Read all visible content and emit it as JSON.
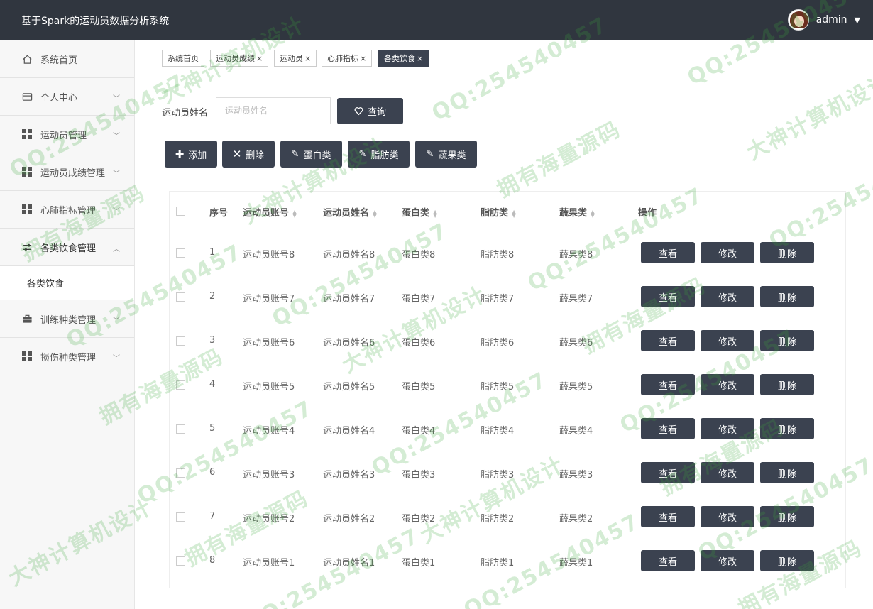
{
  "app": {
    "title": "基于Spark的运动员数据分析系统",
    "user": "admin"
  },
  "sidebar": {
    "items": [
      {
        "label": "系统首页",
        "icon": "home-icon"
      },
      {
        "label": "个人中心",
        "icon": "card-icon"
      },
      {
        "label": "运动员管理",
        "icon": "grid-icon"
      },
      {
        "label": "运动员成绩管理",
        "icon": "grid-icon"
      },
      {
        "label": "心肺指标管理",
        "icon": "grid-icon"
      },
      {
        "label": "各类饮食管理",
        "icon": "sliders-icon"
      },
      {
        "label": "训练种类管理",
        "icon": "briefcase-icon"
      },
      {
        "label": "损伤种类管理",
        "icon": "grid-icon"
      }
    ],
    "sub_item": "各类饮食"
  },
  "tabs": [
    "系统首页",
    "运动员成绩",
    "运动员",
    "心肺指标",
    "各类饮食"
  ],
  "search": {
    "label": "运动员姓名",
    "placeholder": "运动员姓名",
    "button": "查询"
  },
  "toolbar": {
    "add": "添加",
    "delete": "删除",
    "protein": "蛋白类",
    "fat": "脂肪类",
    "veg": "蔬果类"
  },
  "table": {
    "headers": [
      "序号",
      "运动员账号",
      "运动员姓名",
      "蛋白类",
      "脂肪类",
      "蔬果类",
      "操作"
    ],
    "rows": [
      [
        "1",
        "运动员账号8",
        "运动员姓名8",
        "蛋白类8",
        "脂肪类8",
        "蔬果类8"
      ],
      [
        "2",
        "运动员账号7",
        "运动员姓名7",
        "蛋白类7",
        "脂肪类7",
        "蔬果类7"
      ],
      [
        "3",
        "运动员账号6",
        "运动员姓名6",
        "蛋白类6",
        "脂肪类6",
        "蔬果类6"
      ],
      [
        "4",
        "运动员账号5",
        "运动员姓名5",
        "蛋白类5",
        "脂肪类5",
        "蔬果类5"
      ],
      [
        "5",
        "运动员账号4",
        "运动员姓名4",
        "蛋白类4",
        "脂肪类4",
        "蔬果类4"
      ],
      [
        "6",
        "运动员账号3",
        "运动员姓名3",
        "蛋白类3",
        "脂肪类3",
        "蔬果类3"
      ],
      [
        "7",
        "运动员账号2",
        "运动员姓名2",
        "蛋白类2",
        "脂肪类2",
        "蔬果类2"
      ],
      [
        "8",
        "运动员账号1",
        "运动员姓名1",
        "蛋白类1",
        "脂肪类1",
        "蔬果类1"
      ]
    ],
    "actions": {
      "view": "查看",
      "edit": "修改",
      "delete": "删除"
    }
  },
  "watermarks": [
    "QQ:254540457",
    "大神计算机设计",
    "拥有海量源码"
  ],
  "colors": {
    "header": "#30363f",
    "button": "#3b4250",
    "watermark": "#3caa3c"
  }
}
